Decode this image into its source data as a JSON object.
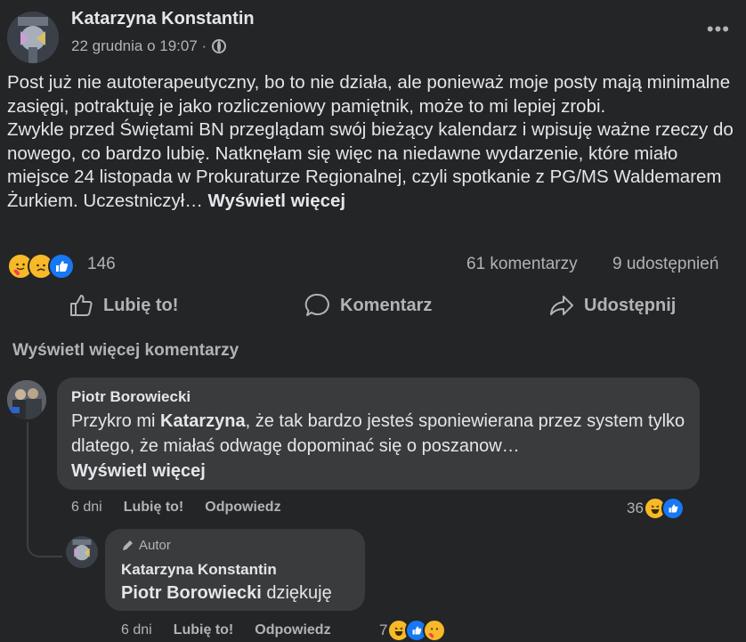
{
  "post": {
    "author": "Katarzyna Konstantin",
    "date": "22 grudnia o 19:07 ·",
    "text_lines": [
      "Post już nie autoterapeutyczny, bo to nie działa, ale ponieważ moje posty mają minimalne zasięgi, potraktuję je jako rozliczeniowy pamiętnik,  może to mi lepiej zrobi.",
      "Zwykle przed Świętami BN przeglądam swój bieżący kalendarz i wpisuję ważne rzeczy do nowego, co bardzo lubię. Natknęłam się więc na niedawne wydarzenie, które miało miejsce 24 listopada w Prokuraturze Regionalnej, czyli spotkanie z PG/MS Waldemarem Żurkiem. Uczestniczył…"
    ],
    "see_more": "Wyświetl więcej",
    "reactions_count": "146",
    "comments_count": "61 komentarzy",
    "shares_count": "9 udostępnień",
    "reaction_icons": [
      "care-emoji-icon",
      "sad-emoji-icon",
      "like-emoji-icon"
    ]
  },
  "actions": {
    "like": "Lubię to!",
    "comment": "Komentarz",
    "share": "Udostępnij"
  },
  "view_more_comments": "Wyświetl więcej komentarzy",
  "comments": [
    {
      "author": "Piotr Borowiecki",
      "mention": "Katarzyna",
      "text_before": "Przykro mi ",
      "text_after": ", że tak bardzo jesteś sponiewierana przez system tylko dlatego, że miałaś odwagę dopominać się o poszanow…",
      "see_more": "Wyświetl więcej",
      "time": "6 dni",
      "like": "Lubię to!",
      "reply": "Odpowiedz",
      "reactions_count": "36",
      "reaction_icons": [
        "haha-emoji-icon",
        "like-emoji-icon"
      ]
    },
    {
      "badge": "Autor",
      "author": "Katarzyna Konstantin",
      "mention": "Piotr Borowiecki",
      "text_after": " dziękuję",
      "time": "6 dni",
      "like": "Lubię to!",
      "reply": "Odpowiedz",
      "reactions_count": "7",
      "reaction_icons": [
        "haha-emoji-icon",
        "like-emoji-icon",
        "care-emoji-icon"
      ]
    }
  ],
  "colors": {
    "background": "#242526",
    "bubble": "#3a3b3c",
    "text_primary": "#e4e6eb",
    "text_secondary": "#b0b3b8",
    "like_blue": "#1877f2",
    "emoji_yellow": "#f7b928"
  }
}
